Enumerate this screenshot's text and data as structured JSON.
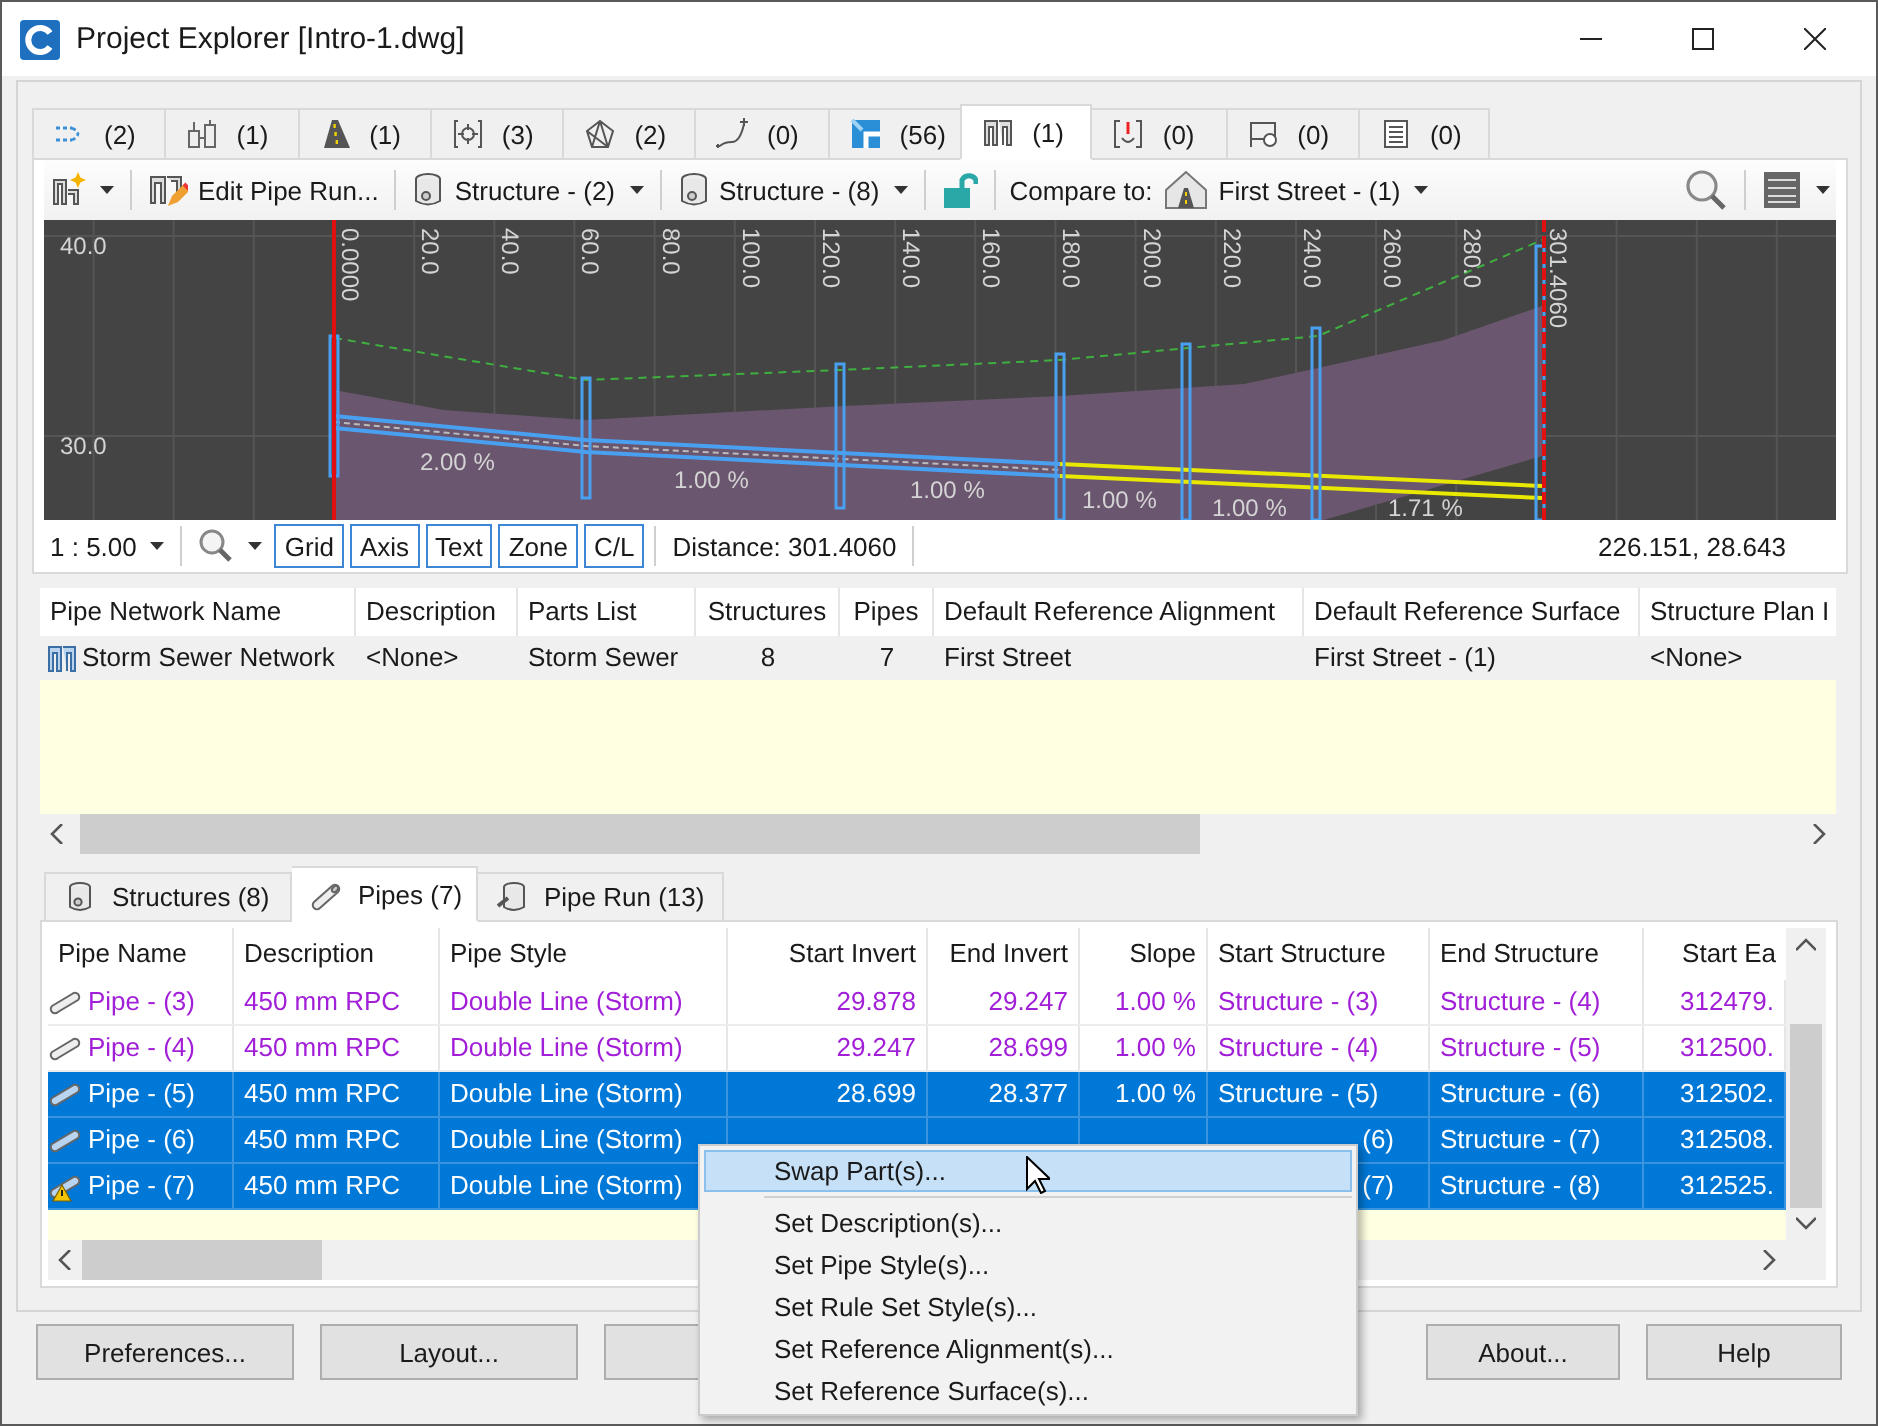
{
  "window": {
    "title": "Project Explorer [Intro-1.dwg]"
  },
  "object_tabs": [
    {
      "kind": "alignment",
      "count": "(2)",
      "selected": false
    },
    {
      "kind": "site",
      "count": "(1)",
      "selected": false
    },
    {
      "kind": "corridor",
      "count": "(1)",
      "selected": false
    },
    {
      "kind": "point-group",
      "count": "(3)",
      "selected": false
    },
    {
      "kind": "surface",
      "count": "(2)",
      "selected": false
    },
    {
      "kind": "feature-line",
      "count": "(0)",
      "selected": false
    },
    {
      "kind": "parcel",
      "count": "(56)",
      "selected": false
    },
    {
      "kind": "pipe-network",
      "count": "(1)",
      "selected": true
    },
    {
      "kind": "pressure-network",
      "count": "(0)",
      "selected": false
    },
    {
      "kind": "view-frame",
      "count": "(0)",
      "selected": false
    },
    {
      "kind": "sheet",
      "count": "(0)",
      "selected": false
    }
  ],
  "toolbar": {
    "edit_button": "Edit Pipe Run...",
    "start_structure": "Structure - (2)",
    "end_structure": "Structure - (8)",
    "locked": false,
    "compare_label": "Compare to:",
    "compare_value": "First Street - (1)"
  },
  "profile": {
    "y_labels": [
      "40.0",
      "30.0"
    ],
    "station_labels": [
      "0.0000",
      "20.0",
      "40.0",
      "60.0",
      "80.0",
      "100.0",
      "120.0",
      "140.0",
      "160.0",
      "180.0",
      "200.0",
      "220.0",
      "240.0",
      "260.0",
      "280.0",
      "301.4060"
    ],
    "slope_labels": [
      "2.00 %",
      "1.00 %",
      "1.00 %",
      "1.00 %",
      "1.00 %",
      "1.71 %"
    ]
  },
  "profile_status": {
    "scale": "1 : 5.00",
    "toggles": [
      {
        "label": "Grid",
        "on": true
      },
      {
        "label": "Axis",
        "on": true
      },
      {
        "label": "Text",
        "on": true
      },
      {
        "label": "Zone",
        "on": true
      },
      {
        "label": "C/L",
        "on": true
      }
    ],
    "distance": "Distance: 301.4060",
    "coordinates": "226.151, 28.643"
  },
  "network_table": {
    "columns": [
      "Pipe Network Name",
      "Description",
      "Parts List",
      "Structures",
      "Pipes",
      "Default Reference Alignment",
      "Default Reference Surface",
      "Structure Plan I"
    ],
    "rows": [
      {
        "cells": [
          "Storm Sewer Network",
          "<None>",
          "Storm Sewer",
          "8",
          "7",
          "First Street",
          "First Street - (1)",
          "<None>"
        ],
        "selected": true
      }
    ]
  },
  "part_tabs": [
    {
      "kind": "structure",
      "label": "Structures (8)",
      "selected": false
    },
    {
      "kind": "pipe",
      "label": "Pipes (7)",
      "selected": true
    },
    {
      "kind": "pipe-run",
      "label": "Pipe Run (13)",
      "selected": false
    }
  ],
  "parts_table": {
    "columns": [
      "Pipe Name",
      "Description",
      "Pipe Style",
      "Start Invert",
      "End Invert",
      "Slope",
      "Start Structure",
      "End Structure",
      "Start Ea"
    ],
    "rows": [
      {
        "cells": [
          "Pipe - (3)",
          "450 mm RPC",
          "Double Line (Storm)",
          "29.878",
          "29.247",
          "1.00 %",
          "Structure - (3)",
          "Structure - (4)",
          "312479."
        ],
        "selected": false,
        "warning": false
      },
      {
        "cells": [
          "Pipe - (4)",
          "450 mm RPC",
          "Double Line (Storm)",
          "29.247",
          "28.699",
          "1.00 %",
          "Structure - (4)",
          "Structure - (5)",
          "312500."
        ],
        "selected": false,
        "warning": false
      },
      {
        "cells": [
          "Pipe - (5)",
          "450 mm RPC",
          "Double Line (Storm)",
          "28.699",
          "28.377",
          "1.00 %",
          "Structure - (5)",
          "Structure - (6)",
          "312502."
        ],
        "selected": true,
        "warning": false
      },
      {
        "cells": [
          "Pipe - (6)",
          "450 mm RPC",
          "Double Line (Storm)",
          null,
          null,
          null,
          {
            "text": "(6)",
            "clipped": true
          },
          "Structure - (7)",
          "312508."
        ],
        "selected": true,
        "warning": false
      },
      {
        "cells": [
          "Pipe - (7)",
          "450 mm RPC",
          "Double Line (Storm)",
          null,
          null,
          null,
          {
            "text": "(7)",
            "clipped": true
          },
          "Structure - (8)",
          "312525."
        ],
        "selected": true,
        "warning": true
      }
    ]
  },
  "buttons": [
    {
      "label": "Preferences...",
      "covered": false
    },
    {
      "label": "Layout...",
      "covered": false
    },
    {
      "covered": true
    },
    {
      "label": "About...",
      "covered": false
    },
    {
      "label": "Help",
      "covered": false
    }
  ],
  "context_menu": {
    "items": [
      {
        "kind": "item",
        "label": "Swap Part(s)...",
        "selected": true
      },
      {
        "kind": "separator"
      },
      {
        "kind": "item",
        "label": "Set Description(s)...",
        "selected": false
      },
      {
        "kind": "item",
        "label": "Set Pipe Style(s)...",
        "selected": false
      },
      {
        "kind": "item",
        "label": "Set Rule Set Style(s)...",
        "selected": false
      },
      {
        "kind": "item",
        "label": "Set Reference Alignment(s)...",
        "selected": false
      },
      {
        "kind": "item",
        "label": "Set Reference Surface(s)...",
        "selected": false
      }
    ]
  }
}
